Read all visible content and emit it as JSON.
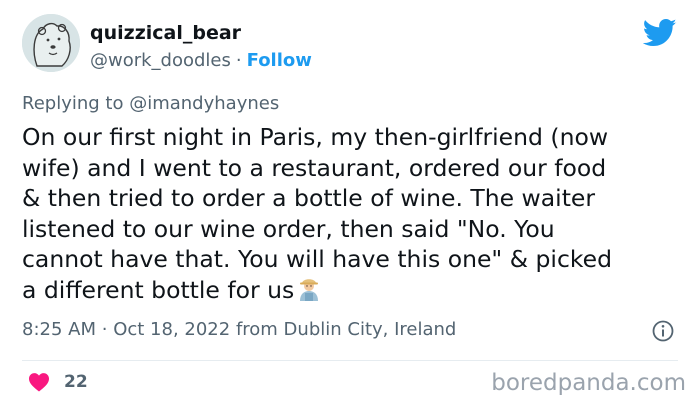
{
  "author": {
    "display_name": "quizzical_bear",
    "handle": "@work_doodles",
    "separator": "·",
    "follow_label": "Follow"
  },
  "reply": {
    "prefix": "Replying to ",
    "to_handle": "@imandyhaynes"
  },
  "tweet": {
    "text": "On our first night in Paris, my then-girlfriend (now\nwife) and I went to a restaurant, ordered our food\n& then tried to order a bottle of wine. The waiter\nlistened to our wine order, then said \"No. You\ncannot have that. You will have this one\" & picked\na different bottle for us",
    "emoji": "man-farmer-emoji"
  },
  "meta": {
    "time": "8:25 AM",
    "separator": "·",
    "date": "Oct 18, 2022",
    "location": "from Dublin City, Ireland"
  },
  "stats": {
    "likes": "22"
  },
  "icons": {
    "brand": "twitter-bird-icon",
    "info": "info-icon",
    "like": "heart-icon"
  },
  "colors": {
    "accent": "#1d9bf0",
    "like": "#f91880",
    "muted": "#536471"
  },
  "watermark": "boredpanda.com"
}
